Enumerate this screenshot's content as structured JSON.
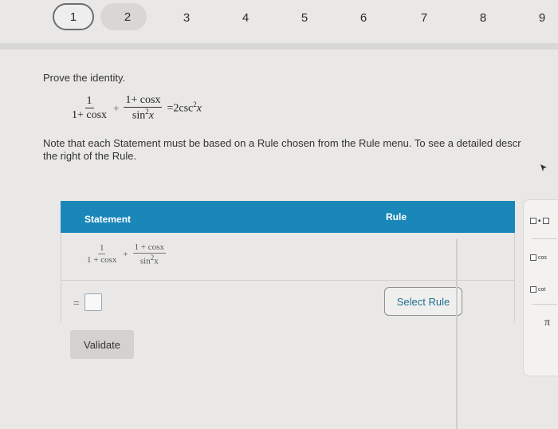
{
  "stepper": {
    "steps": [
      "1",
      "2",
      "3",
      "4",
      "5",
      "6",
      "7",
      "8",
      "9"
    ],
    "active_index": 0
  },
  "prompt": "Prove the identity.",
  "identity": {
    "lhs1_num": "1",
    "lhs1_den": "1+ cosx",
    "plus": "+",
    "lhs2_num": "1+ cosx",
    "lhs2_den": "sin",
    "lhs2_den_exp": "2",
    "lhs2_den_var": "x",
    "equals_coef": "=2csc",
    "rhs_exp": "2",
    "rhs_var": "x"
  },
  "note": {
    "line1": "Note that each Statement must be based on a Rule chosen from the Rule menu. To see a detailed descr",
    "line2": "the right of the Rule."
  },
  "table": {
    "header_statement": "Statement",
    "header_rule": "Rule",
    "row1": {
      "f1_num": "1",
      "f1_den": "1 + cosx",
      "plus": "+",
      "f2_num": "1 + cosx",
      "f2_den": "sin",
      "f2_den_exp": "2",
      "f2_den_var": "x"
    },
    "row2": {
      "equals": "=",
      "select_rule_label": "Select Rule"
    },
    "validate_label": "Validate"
  },
  "palette": {
    "items": [
      {
        "icon": "box-dot-box",
        "label": "▢•▢"
      },
      {
        "icon": "cos-box",
        "label": "cos"
      },
      {
        "icon": "cot-box",
        "label": "cot"
      },
      {
        "icon": "pi",
        "label": "π"
      }
    ]
  },
  "colors": {
    "header_bg": "#1a87b9",
    "select_rule_text": "#1f6f94",
    "page_bg": "#e9e8e6"
  }
}
